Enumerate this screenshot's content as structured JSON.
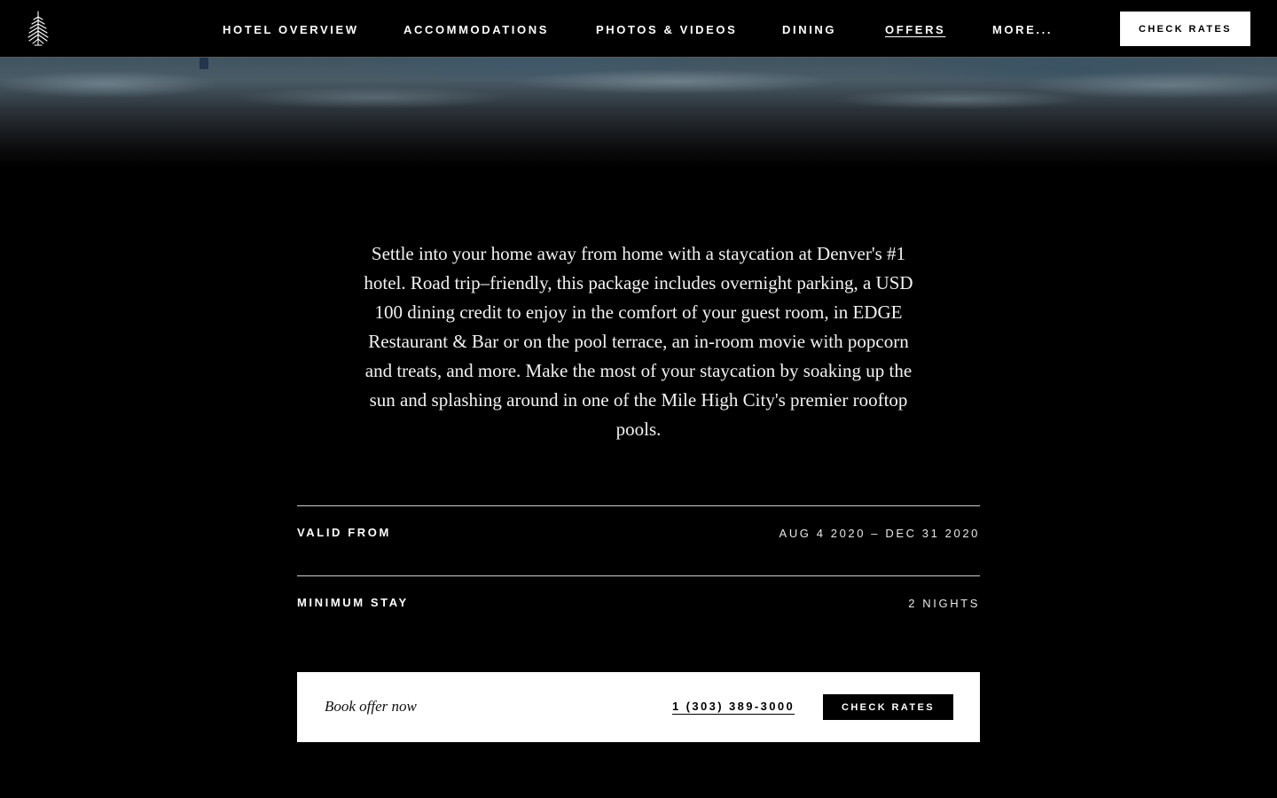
{
  "header": {
    "logo_icon": "tree-logo-icon",
    "nav": [
      {
        "label": "HOTEL OVERVIEW",
        "active": false
      },
      {
        "label": "ACCOMMODATIONS",
        "active": false
      },
      {
        "label": "PHOTOS & VIDEOS",
        "active": false
      },
      {
        "label": "DINING",
        "active": false
      },
      {
        "label": "OFFERS",
        "active": true
      },
      {
        "label": "MORE...",
        "active": false
      }
    ],
    "cta_label": "CHECK RATES"
  },
  "offer": {
    "description": "Settle into your home away from home with a staycation at Denver's #1 hotel. Road trip–friendly, this package includes overnight parking, a USD 100 dining credit to enjoy in the comfort of your guest room, in EDGE Restaurant & Bar or on the pool terrace, an in-room movie with popcorn and treats, and more. Make the most of your staycation by soaking up the sun and splashing around in one of the Mile High City's premier rooftop pools.",
    "details": [
      {
        "label": "VALID FROM",
        "value": "AUG 4 2020 – DEC 31 2020"
      },
      {
        "label": "MINIMUM STAY",
        "value": "2 NIGHTS"
      }
    ]
  },
  "booking": {
    "text": "Book offer now",
    "phone": "1 (303) 389-3000",
    "cta_label": "CHECK RATES"
  },
  "colors": {
    "background": "#000000",
    "text": "#ffffff",
    "booking_bar": "#ffffff"
  }
}
